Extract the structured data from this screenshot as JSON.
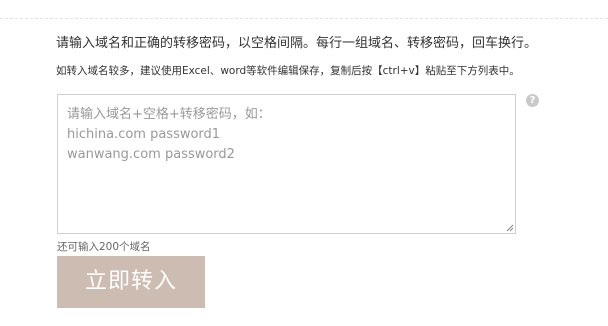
{
  "instructions": {
    "main": "请输入域名和正确的转移密码，以空格间隔。每行一组域名、转移密码，回车换行。",
    "tip": "如转入域名较多，建议使用Excel、word等软件编辑保存，复制后按【ctrl+v】粘贴至下方列表中。"
  },
  "domain_input": {
    "placeholder": "请输入域名+空格+转移密码，如：\nhichina.com password1\nwanwang.com password2",
    "value": ""
  },
  "help": {
    "icon": "question-mark-icon",
    "glyph": "?"
  },
  "remaining_text": "还可输入200个域名",
  "submit": {
    "label": "立即转入"
  },
  "colors": {
    "button_bg": "#cdbcb1",
    "help_icon_bg": "#c9c9c9",
    "border": "#cfcfcf"
  }
}
